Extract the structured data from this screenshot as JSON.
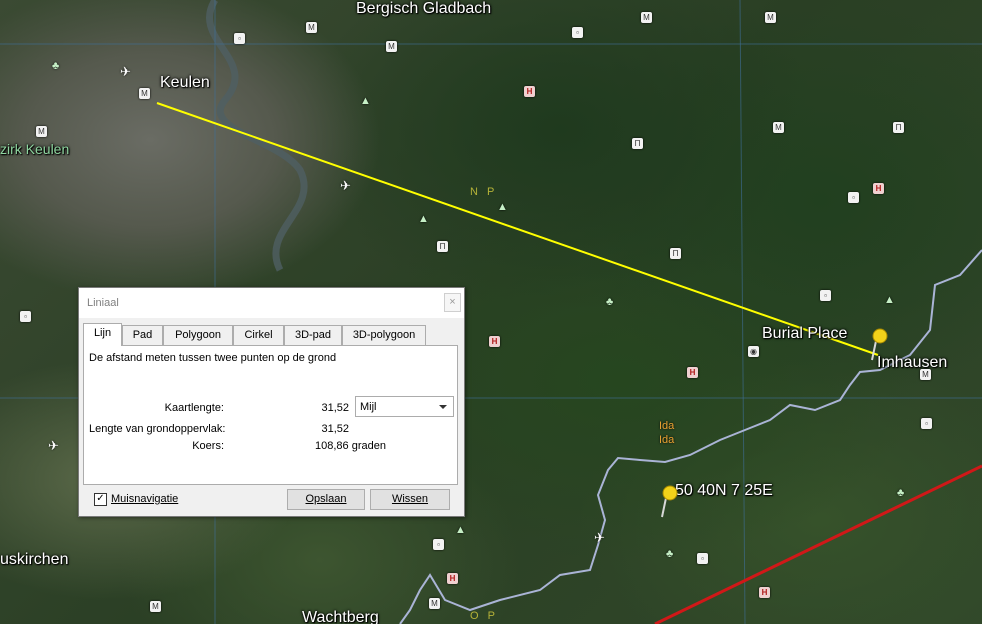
{
  "map": {
    "places": {
      "bergisch": "Bergisch Gladbach",
      "keulen": "Keulen",
      "kreis": "zirk Keulen",
      "burial": "Burial Place",
      "imhausen": "Imhausen",
      "coords": "50 40N  7 25E",
      "euskirchen": "uskirchen",
      "wachtberg": "Wachtberg",
      "ida1": "Ida",
      "ida2": "Ida",
      "np": "N P",
      "op": "O P"
    },
    "colors": {
      "ruler_line": "#ffff00",
      "border_line": "#b0b8d8",
      "red_line": "#d01818"
    }
  },
  "dialog": {
    "title": "Liniaal",
    "close": "×",
    "tabs": [
      "Lijn",
      "Pad",
      "Polygoon",
      "Cirkel",
      "3D-pad",
      "3D-polygoon"
    ],
    "description": "De afstand meten tussen twee punten op de grond",
    "map_length_label": "Kaartlengte:",
    "map_length_value": "31,52",
    "unit": "Mijl",
    "ground_length_label": "Lengte van grondoppervlak:",
    "ground_length_value": "31,52",
    "heading_label": "Koers:",
    "heading_value": "108,86 graden",
    "mouse_nav_checked": "✓",
    "mouse_nav_label": "Muisnavigatie",
    "save_label": "Opslaan",
    "clear_label": "Wissen"
  }
}
